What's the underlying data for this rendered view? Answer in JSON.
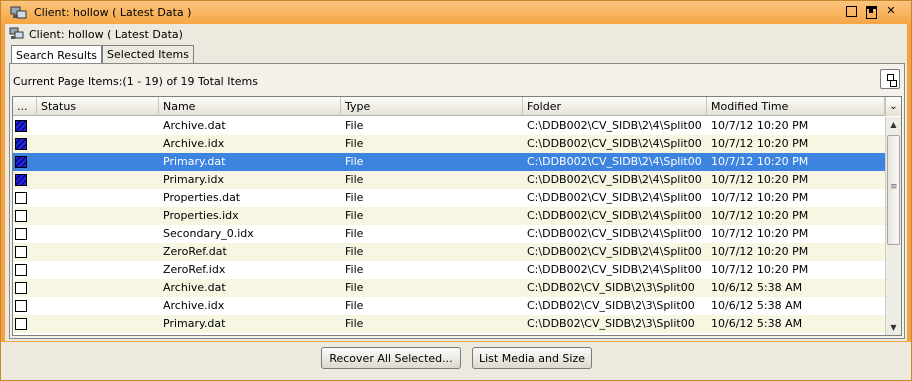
{
  "window": {
    "title": "Client: hollow ( Latest Data )",
    "subtitle": "Client: hollow ( Latest Data)",
    "controls": [
      "minimize",
      "maximize",
      "close"
    ],
    "close_glyph": "✕"
  },
  "tabs": [
    {
      "label": "Search Results",
      "active": true
    },
    {
      "label": "Selected Items",
      "active": false
    }
  ],
  "page_items_text": "Current Page Items:(1 - 19) of 19 Total Items",
  "table": {
    "columns": [
      "...",
      "Status",
      "Name",
      "Type",
      "Folder",
      "Modified Time"
    ],
    "column_menu_glyph": "⌄",
    "rows": [
      {
        "checked": true,
        "selected": false,
        "status": "",
        "name": "Archive.dat",
        "type": "File",
        "folder": "C:\\DDB002\\CV_SIDB\\2\\4\\Split00",
        "modified": "10/7/12 10:20 PM"
      },
      {
        "checked": true,
        "selected": false,
        "status": "",
        "name": "Archive.idx",
        "type": "File",
        "folder": "C:\\DDB002\\CV_SIDB\\2\\4\\Split00",
        "modified": "10/7/12 10:20 PM"
      },
      {
        "checked": true,
        "selected": true,
        "status": "",
        "name": "Primary.dat",
        "type": "File",
        "folder": "C:\\DDB002\\CV_SIDB\\2\\4\\Split00",
        "modified": "10/7/12 10:20 PM"
      },
      {
        "checked": true,
        "selected": false,
        "status": "",
        "name": "Primary.idx",
        "type": "File",
        "folder": "C:\\DDB002\\CV_SIDB\\2\\4\\Split00",
        "modified": "10/7/12 10:20 PM"
      },
      {
        "checked": false,
        "selected": false,
        "status": "",
        "name": "Properties.dat",
        "type": "File",
        "folder": "C:\\DDB002\\CV_SIDB\\2\\4\\Split00",
        "modified": "10/7/12 10:20 PM"
      },
      {
        "checked": false,
        "selected": false,
        "status": "",
        "name": "Properties.idx",
        "type": "File",
        "folder": "C:\\DDB002\\CV_SIDB\\2\\4\\Split00",
        "modified": "10/7/12 10:20 PM"
      },
      {
        "checked": false,
        "selected": false,
        "status": "",
        "name": "Secondary_0.idx",
        "type": "File",
        "folder": "C:\\DDB002\\CV_SIDB\\2\\4\\Split00",
        "modified": "10/7/12 10:20 PM"
      },
      {
        "checked": false,
        "selected": false,
        "status": "",
        "name": "ZeroRef.dat",
        "type": "File",
        "folder": "C:\\DDB002\\CV_SIDB\\2\\4\\Split00",
        "modified": "10/7/12 10:20 PM"
      },
      {
        "checked": false,
        "selected": false,
        "status": "",
        "name": "ZeroRef.idx",
        "type": "File",
        "folder": "C:\\DDB002\\CV_SIDB\\2\\4\\Split00",
        "modified": "10/7/12 10:20 PM"
      },
      {
        "checked": false,
        "selected": false,
        "status": "",
        "name": "Archive.dat",
        "type": "File",
        "folder": "C:\\DDB02\\CV_SIDB\\2\\3\\Split00",
        "modified": "10/6/12 5:38 AM"
      },
      {
        "checked": false,
        "selected": false,
        "status": "",
        "name": "Archive.idx",
        "type": "File",
        "folder": "C:\\DDB02\\CV_SIDB\\2\\3\\Split00",
        "modified": "10/6/12 5:38 AM"
      },
      {
        "checked": false,
        "selected": false,
        "status": "",
        "name": "Primary.dat",
        "type": "File",
        "folder": "C:\\DDB02\\CV_SIDB\\2\\3\\Split00",
        "modified": "10/6/12 5:38 AM"
      }
    ]
  },
  "scrollbar": {
    "up_glyph": "▲",
    "down_glyph": "▼"
  },
  "buttons": {
    "recover": "Recover All Selected...",
    "media": "List Media and Size"
  },
  "colors": {
    "title_bar": "#f5a544",
    "selection": "#3d84e0",
    "checkbox_checked": "#1a1ac0"
  }
}
